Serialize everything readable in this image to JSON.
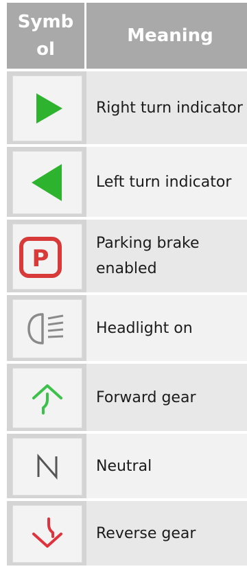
{
  "header": {
    "symbol_label": "Symbol",
    "meaning_label": "Meaning"
  },
  "rows": [
    {
      "icon": "right-triangle-icon",
      "color": "#2db32d",
      "meaning": "Right turn indicator"
    },
    {
      "icon": "left-triangle-icon",
      "color": "#2db32d",
      "meaning": "Left turn indicator"
    },
    {
      "icon": "parking-brake-icon",
      "color": "#d83a3a",
      "meaning": "Parking brake enabled"
    },
    {
      "icon": "headlight-icon",
      "color": "#8a8a8a",
      "meaning": "Headlight on"
    },
    {
      "icon": "forward-arrow-icon",
      "color": "#3cc24a",
      "meaning": "Forward gear"
    },
    {
      "icon": "neutral-n-icon",
      "color": "#555555",
      "meaning": "Neutral"
    },
    {
      "icon": "reverse-arrow-icon",
      "color": "#e0323c",
      "meaning": "Reverse gear"
    }
  ]
}
